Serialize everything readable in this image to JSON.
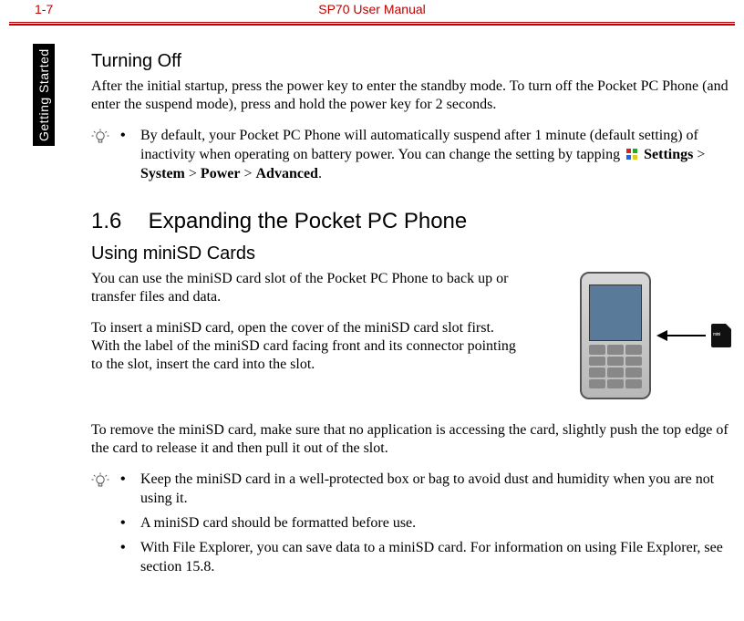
{
  "header": {
    "page_number": "1-7",
    "manual_title": "SP70 User Manual"
  },
  "side_tab": "Getting Started",
  "turning_off": {
    "heading": "Turning Off",
    "body": "After the initial startup, press the power key to enter the standby mode. To turn off the Pocket PC Phone (and enter the suspend mode), press and hold the power key for 2 seconds."
  },
  "tip1": {
    "text_pre": "By default, your Pocket PC Phone will automatically suspend after 1 minute (default setting) of inactivity when operating on battery power. You can change the setting by tapping ",
    "bold1": "Settings",
    "mid1": " > ",
    "bold2": "System",
    "mid2": " > ",
    "bold3": "Power",
    "mid3": " > ",
    "bold4": "Advanced",
    "post": "."
  },
  "section16": {
    "number": "1.6",
    "title": "Expanding the Pocket PC Phone"
  },
  "minisd": {
    "heading": "Using miniSD Cards",
    "p1": "You can use the miniSD card slot of the Pocket PC Phone to back up or transfer files and data.",
    "p2": "To insert a miniSD card, open the cover of the miniSD card slot first. With the label of the miniSD card facing front and its connector pointing to the slot, insert the card into the slot.",
    "p3": "To remove the miniSD card, make sure that no application is accessing the card, slightly push the top edge of the card to release it and then pull it out of the slot."
  },
  "tip2": {
    "item1": "Keep the miniSD card in a well-protected box or bag to avoid dust and humidity when you are not using it.",
    "item2": "A miniSD card should be formatted before use.",
    "item3": "With File Explorer, you can save data to a miniSD card. For information on using File Explorer, see section 15.8."
  }
}
